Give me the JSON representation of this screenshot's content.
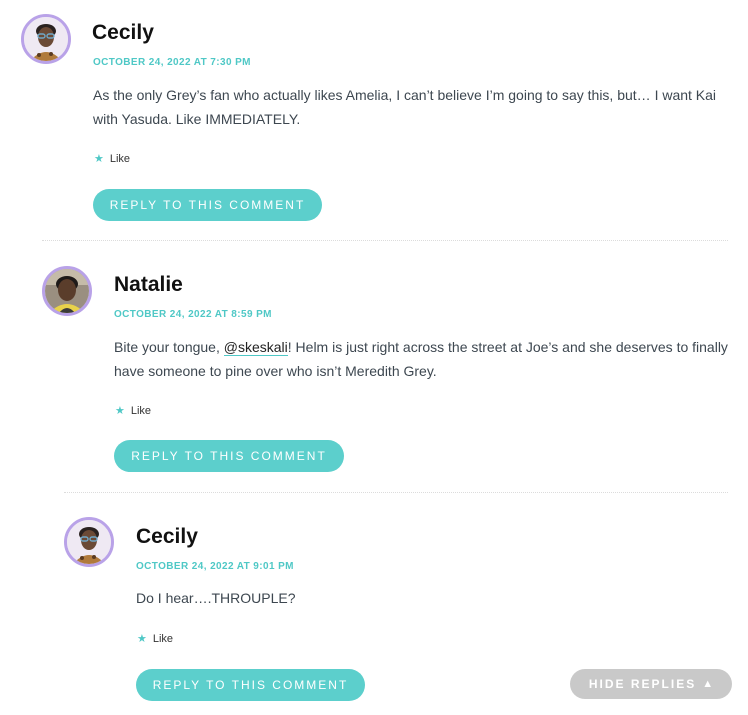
{
  "comments": [
    {
      "author": "Cecily",
      "date": "OCTOBER 24, 2022 AT 7:30 PM",
      "text": "As the only Grey’s fan who actually likes Amelia, I can’t believe I’m going to say this, but… I want Kai with Yasuda. Like IMMEDIATELY.",
      "like_label": "Like",
      "reply_label": "REPLY TO THIS COMMENT"
    },
    {
      "author": "Natalie",
      "date": "OCTOBER 24, 2022 AT 8:59 PM",
      "text_before": "Bite your tongue, ",
      "mention": "@skeskali",
      "text_after": "! Helm is just right across the street at Joe’s and she deserves to finally have someone to pine over who isn’t Meredith Grey.",
      "like_label": "Like",
      "reply_label": "REPLY TO THIS COMMENT"
    },
    {
      "author": "Cecily",
      "date": "OCTOBER 24, 2022 AT 9:01 PM",
      "text": "Do I hear….THROUPLE?",
      "like_label": "Like",
      "reply_label": "REPLY TO THIS COMMENT"
    }
  ],
  "hide_replies_label": "HIDE REPLIES",
  "icons": {
    "like": "star-icon",
    "hide_replies": "triangle-up-icon"
  },
  "colors": {
    "accent": "#4fc8c6",
    "button": "#5ccfcc",
    "avatar_ring": "#b9a2e8",
    "hide_button": "#c9c9c9"
  }
}
